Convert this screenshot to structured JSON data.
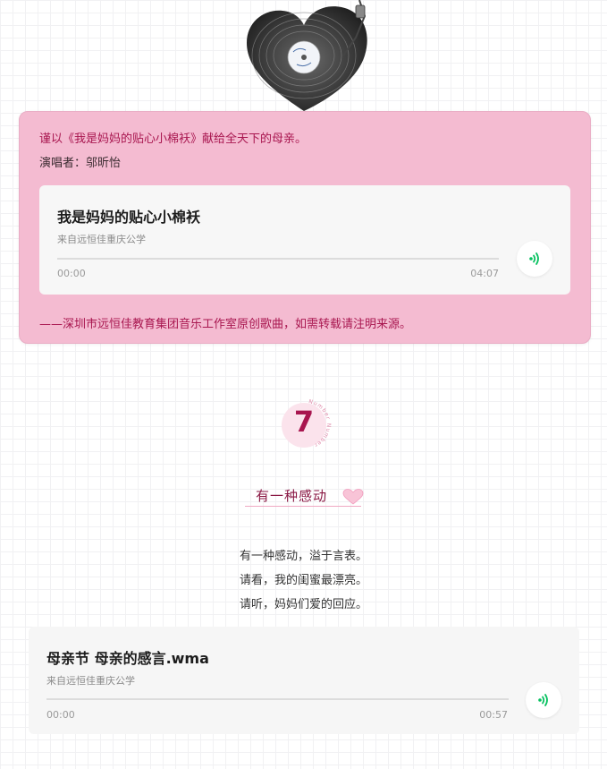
{
  "header_image": {
    "icon": "heart-vinyl-record-icon"
  },
  "dedication_card": {
    "dedication": "谨以《我是妈妈的贴心小棉袄》献给全天下的母亲。",
    "singer": "演唱者：邬昕怡",
    "credit": "——深圳市远恒佳教育集团音乐工作室原创歌曲，如需转载请注明来源。",
    "player": {
      "title": "我是妈妈的贴心小棉袄",
      "source": "来自远恒佳重庆公学",
      "current_time": "00:00",
      "duration": "04:07",
      "progress": 0
    }
  },
  "section": {
    "number": "7",
    "number_ring_text": "Number Number",
    "title": "有一种感动",
    "poem": [
      "有一种感动，溢于言表。",
      "请看，我的闺蜜最漂亮。",
      "请听，妈妈们爱的回应。"
    ],
    "player": {
      "title": "母亲节 母亲的感言.wma",
      "source": "来自远恒佳重庆公学",
      "current_time": "00:00",
      "duration": "00:57",
      "progress": 0
    }
  },
  "colors": {
    "card_pink": "#f4bbd1",
    "accent_magenta": "#a8164f",
    "play_green": "#07c160"
  }
}
